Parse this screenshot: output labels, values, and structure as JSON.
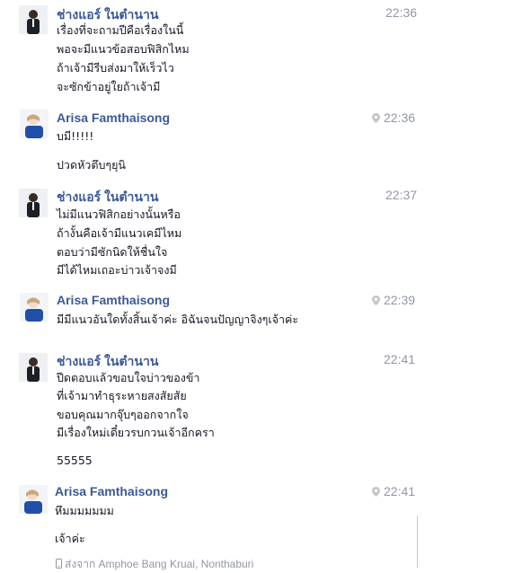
{
  "messages": [
    {
      "sender": "ช่างแอร์ ในตำนาน",
      "time": "22:36",
      "lines": [
        "เรื่องที่จะถามปีคือเรื่องในนี้",
        "พอจะมีแนวข้อสอบฟิสิกไหม",
        "ถ้าเจ้ามีรีบส่งมาให้เร็วไว",
        "จะซักข้าอยู่ใยถ้าเจ้ามี"
      ]
    },
    {
      "sender": "Arisa Famthaisong",
      "time": "22:36",
      "lines": [
        "บมี!!!!!",
        "ปวดหัวตึบๆยุนิ"
      ]
    },
    {
      "sender": "ช่างแอร์ ในตำนาน",
      "time": "22:37",
      "lines": [
        "ไม่มีแนวฟิสิกอย่างนั้นหรือ",
        "ถ้างั้นคือเจ้ามีแนวเคมีไหม",
        "ตอบว่ามีซักนิดให้ชื่นใจ",
        "มีได้ไหมเถอะบ่าวเจ้าจงมี"
      ]
    },
    {
      "sender": "Arisa Famthaisong",
      "time": "22:39",
      "lines": [
        "มีมีแนวอันใดทั้งสิ้นเจ้าค่ะ  อิฉันจนปัญญาจิงๆเจ้าค่ะ"
      ]
    },
    {
      "sender": "ช่างแอร์ ในตำนาน",
      "time": "22:41",
      "lines": [
        "ปีดตอบแล้วขอบใจบ่าวของข้า",
        "ที่เจ้ามาทำธุระหายสงสัยสัย",
        "ขอบคุณมากจุ๊บๆออกจากใจ",
        "มีเรื่องใหม่เดี๋ยวรบกวนเจ้าอีกครา",
        "55555"
      ]
    },
    {
      "sender": "Arisa Famthaisong",
      "time": "22:41",
      "lines": [
        "หึมมมมมมม",
        "เจ้าค่ะ"
      ],
      "location": "ส่งจาก Amphoe Bang Kruai, Nonthaburi"
    }
  ],
  "colors": {
    "name": "#3b5998",
    "time": "#9197a3",
    "text": "#141823"
  },
  "icons": {
    "pin": "location-pin-icon",
    "phone": "mobile-phone-icon"
  }
}
